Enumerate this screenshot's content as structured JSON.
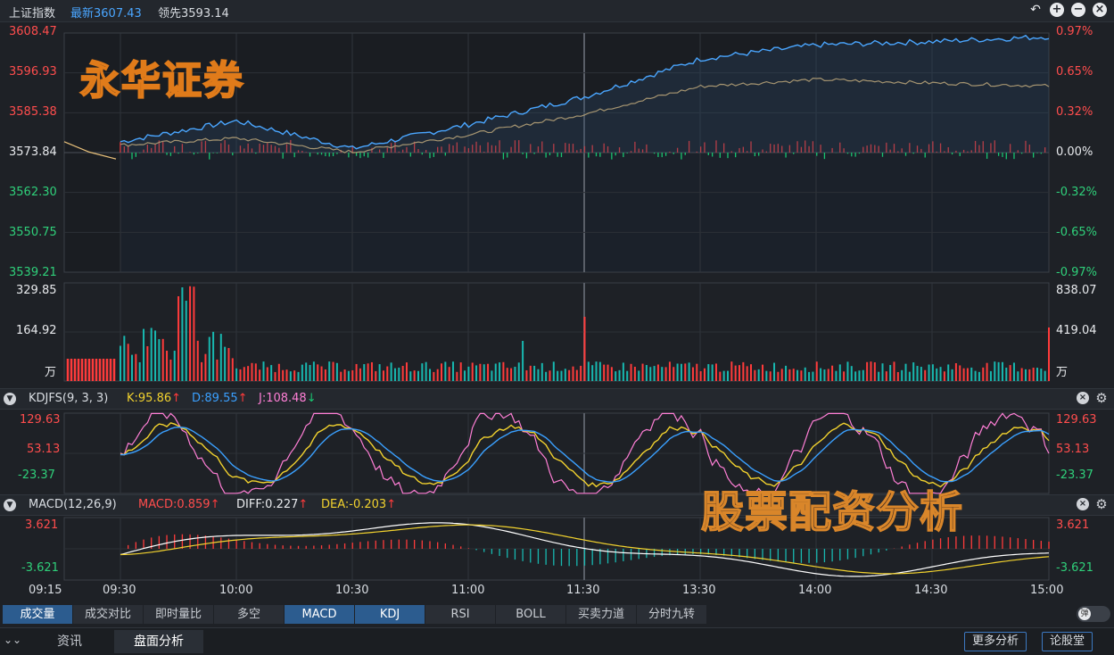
{
  "header": {
    "title": "上证指数",
    "latest": "最新3607.43",
    "lead": "领先3593.14",
    "icons": [
      "undo-icon",
      "zoom-in-icon",
      "zoom-out-icon",
      "close-icon"
    ]
  },
  "watermarks": {
    "brand": "永华证券",
    "subtitle": "股票配资分析"
  },
  "price_chart": {
    "left_ticks": [
      "3608.47",
      "3596.93",
      "3585.38",
      "3573.84",
      "3562.30",
      "3550.75",
      "3539.21"
    ],
    "right_ticks": [
      "0.97%",
      "0.65%",
      "0.32%",
      "0.00%",
      "-0.32%",
      "-0.65%",
      "-0.97%"
    ],
    "colors": {
      "up": "#ff3b3b",
      "down": "#18c470",
      "index_line": "#4aa6ff",
      "lead_line": "#e8c07a"
    }
  },
  "volume_chart": {
    "left_ticks": [
      "329.85",
      "164.92",
      "万"
    ],
    "right_ticks": [
      "838.07",
      "419.04",
      "万"
    ]
  },
  "kdj": {
    "name": "KDJFS(9, 3, 3)",
    "k": "K:95.86",
    "d": "D:89.55",
    "j": "J:108.48",
    "ticks": [
      "129.63",
      "53.13",
      "-23.37"
    ],
    "colors": {
      "k": "#f2d22e",
      "d": "#3aa0ff",
      "j": "#ff7fd6"
    }
  },
  "macd": {
    "name": "MACD(12,26,9)",
    "macd": "MACD:0.859",
    "diff": "DIFF:0.227",
    "dea": "DEA:-0.203",
    "ticks": [
      "3.621",
      "-3.621"
    ]
  },
  "time_axis": [
    "09:15",
    "09:30",
    "10:00",
    "10:30",
    "11:00",
    "11:30",
    "13:30",
    "14:00",
    "14:30",
    "15:00"
  ],
  "indicator_tabs": [
    "成交量",
    "成交对比",
    "即时量比",
    "多空",
    "MACD",
    "KDJ",
    "RSI",
    "BOLL",
    "买卖力道",
    "分时九转"
  ],
  "toggle_label": "弹",
  "bottom_tabs": [
    "资讯",
    "盘面分析"
  ],
  "bottom_buttons": [
    "更多分析",
    "论股堂"
  ],
  "chart_data": {
    "type": "line",
    "title": "上证指数",
    "x": [
      "09:30",
      "10:00",
      "10:30",
      "11:00",
      "11:30",
      "13:30",
      "14:00",
      "14:30",
      "15:00"
    ],
    "series": [
      {
        "name": "最新",
        "values": [
          3577,
          3583,
          3575,
          3582,
          3590,
          3601,
          3605,
          3606,
          3607.43
        ]
      },
      {
        "name": "领先",
        "values": [
          3576,
          3578,
          3574,
          3579,
          3585,
          3593,
          3595,
          3594,
          3593.14
        ]
      }
    ],
    "ylim": [
      3539.21,
      3608.47
    ]
  }
}
